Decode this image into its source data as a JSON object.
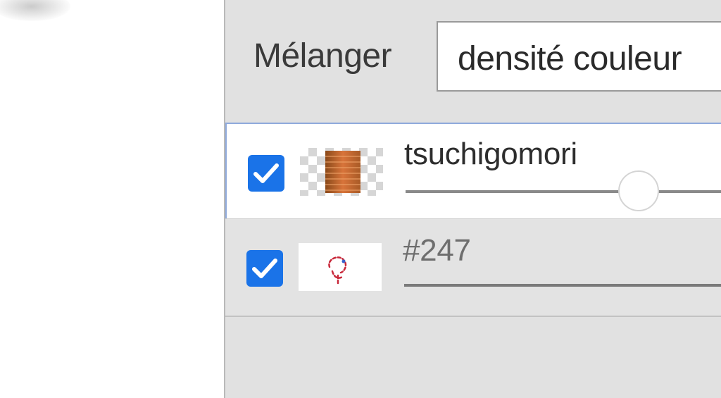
{
  "blend": {
    "label": "Mélanger",
    "mode_value": "densité couleur"
  },
  "layers": [
    {
      "name": "tsuchigomori",
      "visible": true,
      "selected": true,
      "opacity_slider_visible": true
    },
    {
      "name": "#247",
      "visible": true,
      "selected": false,
      "opacity_slider_visible": false
    }
  ],
  "colors": {
    "checkbox": "#1a73e8",
    "selection_border": "#8faadc",
    "panel_bg": "#e1e1e1"
  }
}
